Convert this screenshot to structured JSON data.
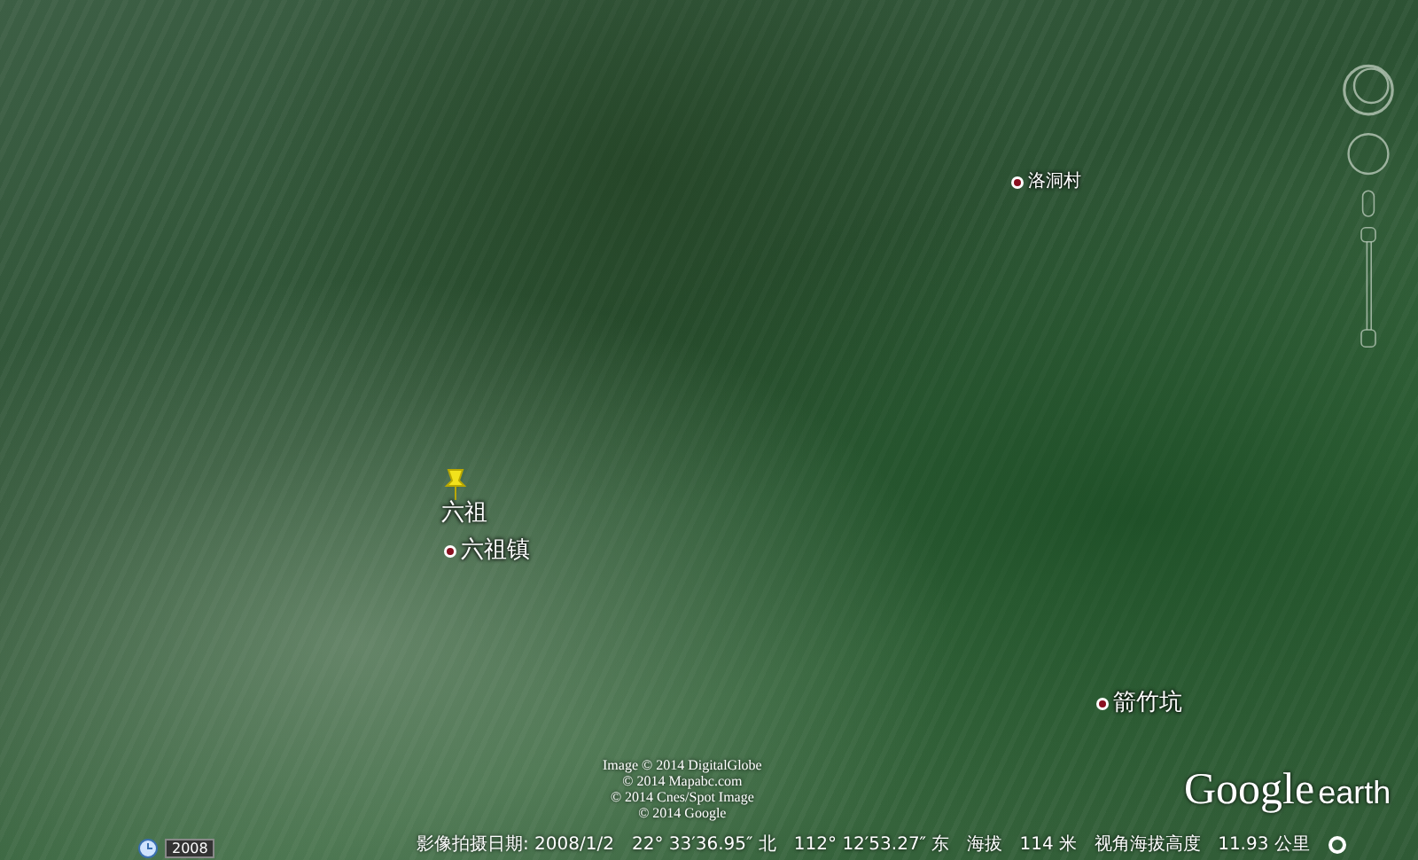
{
  "labels": [
    {
      "text": "六祖",
      "kind": "pin"
    },
    {
      "text": "六祖镇",
      "kind": "town"
    },
    {
      "text": "洛洞村",
      "kind": "village"
    },
    {
      "text": "箭竹坑",
      "kind": "town"
    }
  ],
  "copyright": [
    "Image © 2014 DigitalGlobe",
    "© 2014 Mapabc.com",
    "© 2014 Cnes/Spot Image",
    "© 2014 Google"
  ],
  "timeline": {
    "year": "2008"
  },
  "status_bar": {
    "imagery_date": "影像拍摄日期: 2008/1/2",
    "latitude": "22° 33′36.95″ 北",
    "longitude": "112° 12′53.27″ 东",
    "elevation": "海拔   114 米",
    "eye_altitude": "视角海拔高度   11.93 公里"
  },
  "logo": {
    "brand": "Google",
    "product": "earth"
  }
}
